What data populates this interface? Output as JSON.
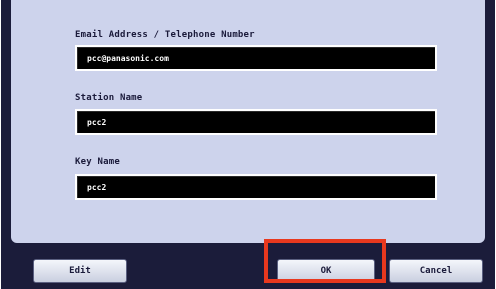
{
  "form": {
    "fields": [
      {
        "label": "Email Address / Telephone Number",
        "value": "pcc@panasonic.com"
      },
      {
        "label": "Station Name",
        "value": "pcc2"
      },
      {
        "label": "Key Name",
        "value": "pcc2"
      }
    ]
  },
  "buttons": {
    "edit": "Edit",
    "ok": "OK",
    "cancel": "Cancel"
  },
  "highlight": {
    "target": "ok-button",
    "color": "#e8381e"
  },
  "colors": {
    "panel": "#cdd3ec",
    "background": "#1b1c3a",
    "field": "#000000"
  }
}
